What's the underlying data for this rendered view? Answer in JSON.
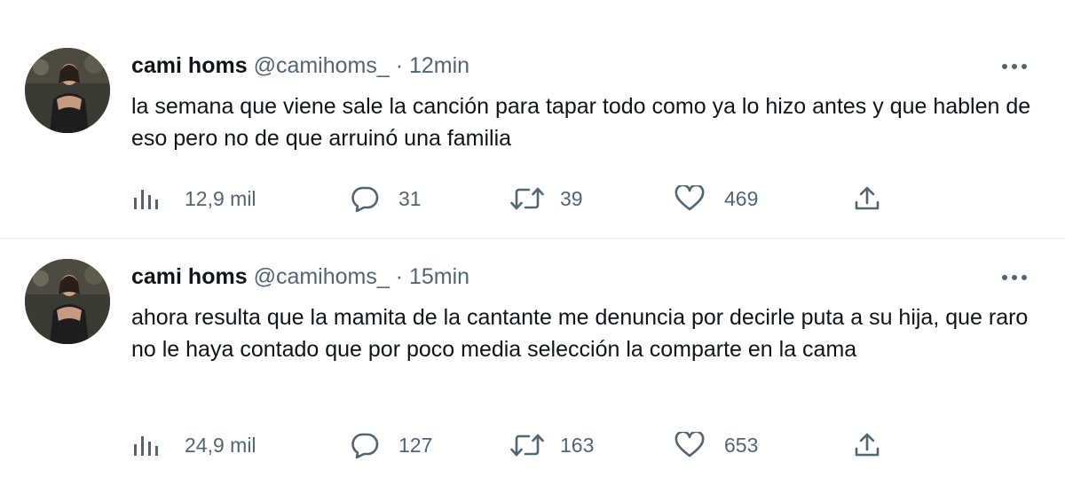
{
  "tweets": [
    {
      "author_name": "cami homs",
      "handle": "@camihoms_",
      "separator": "·",
      "time": "12min",
      "text": "la semana que viene sale la canción para tapar todo como ya lo hizo antes y que hablen de eso pero no de que arruinó una familia",
      "views": "12,9 mil",
      "replies": "31",
      "retweets": "39",
      "likes": "469"
    },
    {
      "author_name": "cami homs",
      "handle": "@camihoms_",
      "separator": "·",
      "time": "15min",
      "text": "ahora resulta que la mamita de la cantante me denuncia por decirle puta a su hija, que raro no le haya contado que por poco media selección la comparte en la cama",
      "views": "24,9 mil",
      "replies": "127",
      "retweets": "163",
      "likes": "653"
    }
  ],
  "icons": {
    "views": "bar-chart-icon",
    "reply": "speech-bubble-icon",
    "retweet": "retweet-arrows-icon",
    "like": "heart-icon",
    "share": "share-upload-icon",
    "more": "more-dots-icon"
  },
  "colors": {
    "text": "#0f1419",
    "secondary": "#536471",
    "divider": "#eff3f4"
  }
}
